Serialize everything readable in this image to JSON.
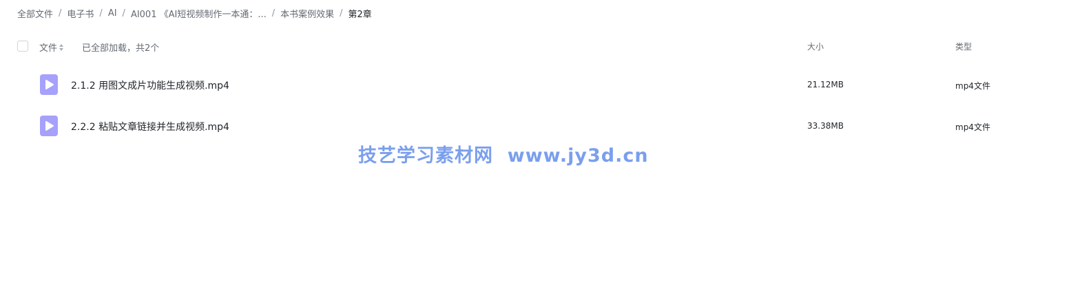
{
  "breadcrumb": {
    "items": [
      "全部文件",
      "电子书",
      "AI",
      "AI001 《AI短视频制作一本通：...",
      "本书案例效果",
      "第2章"
    ],
    "separator": "/"
  },
  "list_header": {
    "name_label": "文件",
    "loaded_info": "已全部加载，共2个",
    "size_label": "大小",
    "type_label": "类型"
  },
  "files": [
    {
      "name": "2.1.2 用图文成片功能生成视频.mp4",
      "size": "21.12MB",
      "type": "mp4文件",
      "icon": "video-file-icon"
    },
    {
      "name": "2.2.2 粘贴文章链接并生成视频.mp4",
      "size": "33.38MB",
      "type": "mp4文件",
      "icon": "video-file-icon"
    }
  ],
  "watermark": {
    "text": "技艺学习素材网  www.jy3d.cn"
  },
  "colors": {
    "file_icon": "#a6a1fb",
    "watermark": "#6f97ec",
    "text_primary": "#1f2329",
    "text_secondary": "#646a73"
  }
}
